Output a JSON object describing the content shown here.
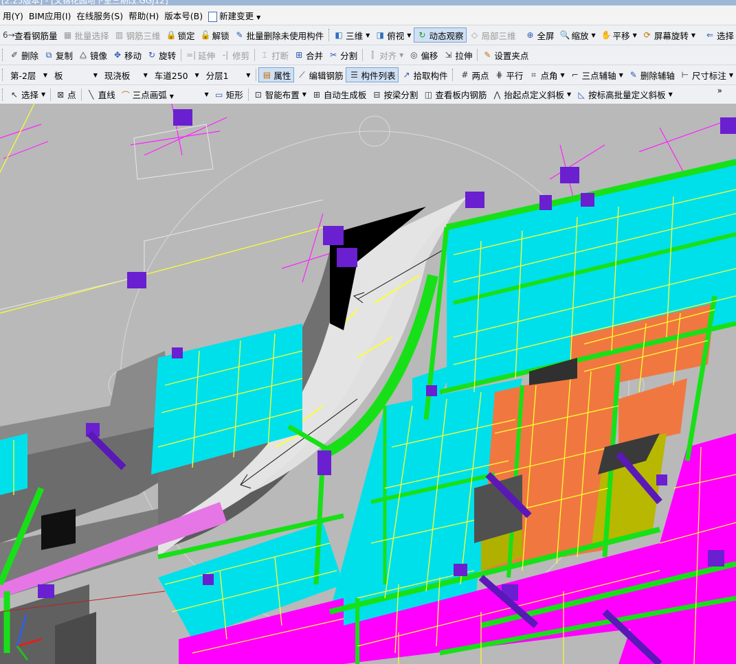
{
  "window": {
    "title": "[2.25版本] - [文锦花园地下室三期改.GGJ12]"
  },
  "menu": [
    "用(Y)",
    "BIM应用(I)",
    "在线服务(S)",
    "帮助(H)",
    "版本号(B)",
    "新建变更"
  ],
  "toolbar1": {
    "items": [
      {
        "label": "查看钢筋量",
        "icon": "view-rebar-icon",
        "disabled": false
      },
      {
        "label": "批量选择",
        "icon": "batch-select-icon",
        "disabled": true
      },
      {
        "label": "钢筋三维",
        "icon": "rebar-3d-icon",
        "disabled": true
      },
      {
        "label": "锁定",
        "icon": "lock-icon",
        "disabled": false
      },
      {
        "label": "解锁",
        "icon": "unlock-icon",
        "disabled": false
      },
      {
        "label": "批量删除未使用构件",
        "icon": "batch-delete-icon",
        "disabled": false
      },
      {
        "label": "三维",
        "icon": "cube-icon",
        "disabled": false,
        "dropdown": true
      },
      {
        "label": "俯视",
        "icon": "top-view-icon",
        "disabled": false,
        "dropdown": true
      },
      {
        "label": "动态观察",
        "icon": "orbit-icon",
        "disabled": false,
        "pressed": true
      },
      {
        "label": "局部三维",
        "icon": "local-3d-icon",
        "disabled": true
      },
      {
        "label": "全屏",
        "icon": "fullscreen-icon",
        "disabled": false
      },
      {
        "label": "缩放",
        "icon": "zoom-icon",
        "disabled": false,
        "dropdown": true
      },
      {
        "label": "平移",
        "icon": "pan-icon",
        "disabled": false,
        "dropdown": true
      },
      {
        "label": "屏幕旋转",
        "icon": "screen-rotate-icon",
        "disabled": false,
        "dropdown": true
      },
      {
        "label": "选择",
        "icon": "select-icon",
        "disabled": false
      }
    ]
  },
  "toolbar2": {
    "items": [
      {
        "label": "删除",
        "icon": "delete-icon",
        "disabled": false
      },
      {
        "label": "复制",
        "icon": "copy-icon",
        "disabled": false
      },
      {
        "label": "镜像",
        "icon": "mirror-icon",
        "disabled": false
      },
      {
        "label": "移动",
        "icon": "move-icon",
        "disabled": false
      },
      {
        "label": "旋转",
        "icon": "rotate-icon",
        "disabled": false
      },
      {
        "label": "延伸",
        "icon": "extend-icon",
        "disabled": true
      },
      {
        "label": "修剪",
        "icon": "trim-icon",
        "disabled": true
      },
      {
        "label": "打断",
        "icon": "break-icon",
        "disabled": true
      },
      {
        "label": "合并",
        "icon": "merge-icon",
        "disabled": false
      },
      {
        "label": "分割",
        "icon": "split-icon",
        "disabled": false
      },
      {
        "label": "对齐",
        "icon": "align-icon",
        "disabled": true,
        "dropdown": true
      },
      {
        "label": "偏移",
        "icon": "offset-icon",
        "disabled": false
      },
      {
        "label": "拉伸",
        "icon": "stretch-icon",
        "disabled": false
      },
      {
        "label": "设置夹点",
        "icon": "grip-point-icon",
        "disabled": false
      }
    ]
  },
  "toolbar3": {
    "floor": "第-2层",
    "category": "板",
    "type": "现浇板",
    "component": "车道250",
    "layer": "分层1",
    "items": [
      {
        "label": "属性",
        "icon": "properties-icon",
        "pressed": true
      },
      {
        "label": "编辑钢筋",
        "icon": "edit-rebar-icon"
      },
      {
        "label": "构件列表",
        "icon": "component-list-icon",
        "pressed": true
      },
      {
        "label": "拾取构件",
        "icon": "pick-component-icon"
      },
      {
        "label": "两点",
        "icon": "two-point-axis-icon"
      },
      {
        "label": "平行",
        "icon": "parallel-axis-icon"
      },
      {
        "label": "点角",
        "icon": "point-angle-icon",
        "dropdown": true
      },
      {
        "label": "三点辅轴",
        "icon": "three-point-axis-icon",
        "dropdown": true
      },
      {
        "label": "删除辅轴",
        "icon": "delete-axis-icon"
      },
      {
        "label": "尺寸标注",
        "icon": "dimension-icon",
        "dropdown": true
      }
    ]
  },
  "toolbar4": {
    "select_label": "选择",
    "point_label": "点",
    "line_label": "直线",
    "arc_mode": "三点画弧",
    "items": [
      {
        "label": "矩形",
        "icon": "rectangle-icon"
      },
      {
        "label": "智能布置",
        "icon": "smart-layout-icon",
        "dropdown": true
      },
      {
        "label": "自动生成板",
        "icon": "auto-slab-icon"
      },
      {
        "label": "按梁分割",
        "icon": "split-by-beam-icon"
      },
      {
        "label": "查看板内钢筋",
        "icon": "view-slab-rebar-icon"
      },
      {
        "label": "抬起点定义斜板",
        "icon": "lift-point-slope-icon",
        "dropdown": true
      },
      {
        "label": "按标高批量定义斜板",
        "icon": "batch-slope-icon",
        "dropdown": true
      }
    ],
    "more": "»"
  },
  "colors": {
    "background": "#b8b8b8",
    "slab_cyan": "#00e0ea",
    "slab_magenta": "#ff00ff",
    "slab_orange": "#f07840",
    "beam_green": "#18e018",
    "column_purple": "#6a1fd0",
    "rebar_yellow": "#ffff30",
    "rebar_magenta": "#ff20ff",
    "ramp_light": "#e2e2e2",
    "wall_dark": "#6c6c6c"
  }
}
